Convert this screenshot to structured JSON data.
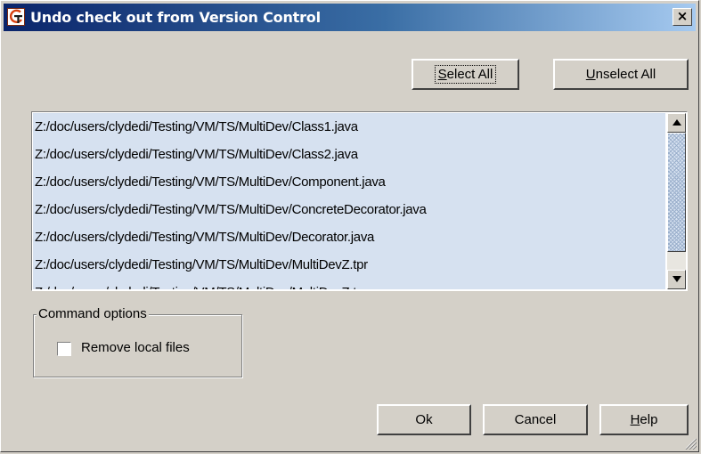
{
  "window": {
    "title": "Undo check out from Version Control",
    "close_label": "×",
    "app_icon": "version-control-app-icon"
  },
  "selection_buttons": {
    "select_all": {
      "prefix": "",
      "accel": "S",
      "suffix": "elect All"
    },
    "unselect_all": {
      "prefix": "",
      "accel": "U",
      "suffix": "nselect All"
    }
  },
  "file_list": {
    "items": [
      "Z:/doc/users/clydedi/Testing/VM/TS/MultiDev/Class1.java",
      "Z:/doc/users/clydedi/Testing/VM/TS/MultiDev/Class2.java",
      "Z:/doc/users/clydedi/Testing/VM/TS/MultiDev/Component.java",
      "Z:/doc/users/clydedi/Testing/VM/TS/MultiDev/ConcreteDecorator.java",
      "Z:/doc/users/clydedi/Testing/VM/TS/MultiDev/Decorator.java",
      "Z:/doc/users/clydedi/Testing/VM/TS/MultiDev/MultiDevZ.tpr",
      "Z:/doc/users/clydedi/Testing/VM/TS/MultiDev/MultiDevZ.tws"
    ],
    "all_selected": true,
    "selection_color": "#d6e1f0"
  },
  "command_options": {
    "legend": "Command options",
    "remove_local_files": {
      "label": "Remove local files",
      "checked": false
    }
  },
  "footer_buttons": {
    "ok": "Ok",
    "cancel": "Cancel",
    "help": {
      "prefix": "",
      "accel": "H",
      "suffix": "elp"
    }
  },
  "colors": {
    "title_gradient_start": "#0a246a",
    "title_gradient_end": "#a6caf0",
    "dialog_face": "#d4d0c8"
  }
}
